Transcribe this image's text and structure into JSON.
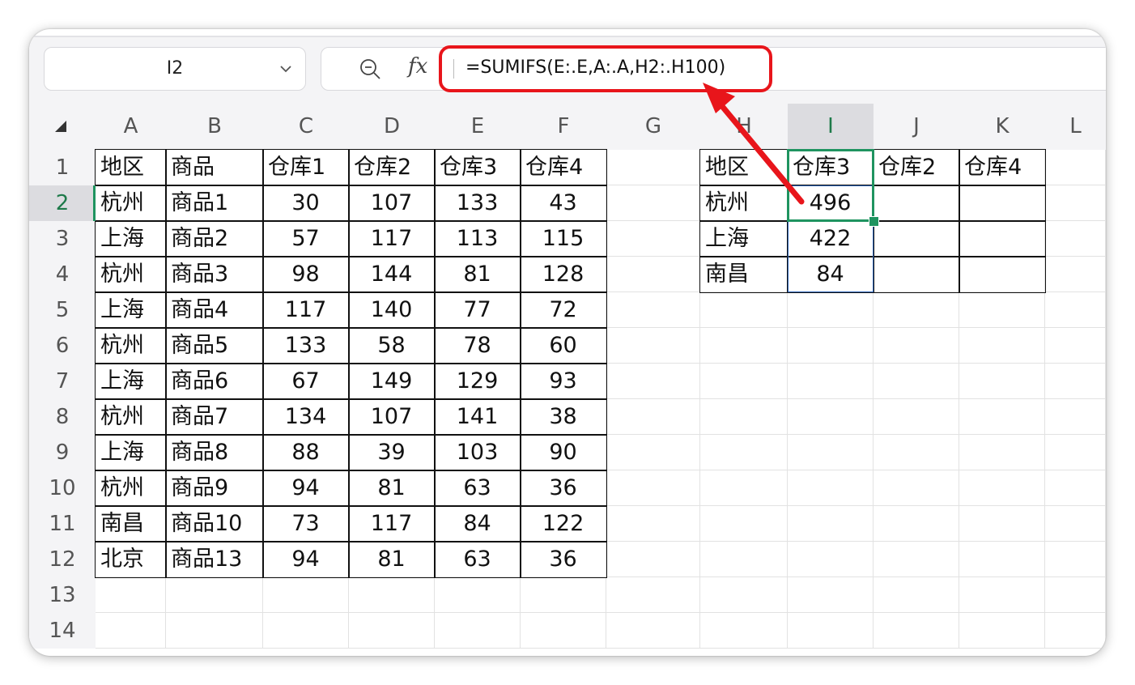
{
  "namebox": {
    "value": "I2"
  },
  "formula_bar": {
    "fx_label": "fx",
    "formula": "=SUMIFS(E:.E,A:.A,H2:.H100)"
  },
  "columns": [
    "A",
    "B",
    "C",
    "D",
    "E",
    "F",
    "G",
    "H",
    "I",
    "J",
    "K",
    "L"
  ],
  "rows": [
    "1",
    "2",
    "3",
    "4",
    "5",
    "6",
    "7",
    "8",
    "9",
    "10",
    "11",
    "12",
    "13",
    "14"
  ],
  "selected_cell": {
    "column": "I",
    "row": "2"
  },
  "source_table": {
    "headers": [
      "地区",
      "商品",
      "仓库1",
      "仓库2",
      "仓库3",
      "仓库4"
    ],
    "rows": [
      [
        "杭州",
        "商品1",
        "30",
        "107",
        "133",
        "43"
      ],
      [
        "上海",
        "商品2",
        "57",
        "117",
        "113",
        "115"
      ],
      [
        "杭州",
        "商品3",
        "98",
        "144",
        "81",
        "128"
      ],
      [
        "上海",
        "商品4",
        "117",
        "140",
        "77",
        "72"
      ],
      [
        "杭州",
        "商品5",
        "133",
        "58",
        "78",
        "60"
      ],
      [
        "上海",
        "商品6",
        "67",
        "149",
        "129",
        "93"
      ],
      [
        "杭州",
        "商品7",
        "134",
        "107",
        "141",
        "38"
      ],
      [
        "上海",
        "商品8",
        "88",
        "39",
        "103",
        "90"
      ],
      [
        "杭州",
        "商品9",
        "94",
        "81",
        "63",
        "36"
      ],
      [
        "南昌",
        "商品10",
        "73",
        "117",
        "84",
        "122"
      ],
      [
        "北京",
        "商品13",
        "94",
        "81",
        "63",
        "36"
      ]
    ]
  },
  "summary_table": {
    "headers": [
      "地区",
      "仓库3",
      "仓库2",
      "仓库4"
    ],
    "rows": [
      [
        "杭州",
        "496",
        "",
        ""
      ],
      [
        "上海",
        "422",
        "",
        ""
      ],
      [
        "南昌",
        "84",
        "",
        ""
      ]
    ]
  },
  "colors": {
    "annotation": "#e8151b",
    "selection": "#1f9460",
    "range": "#2d64b8"
  }
}
